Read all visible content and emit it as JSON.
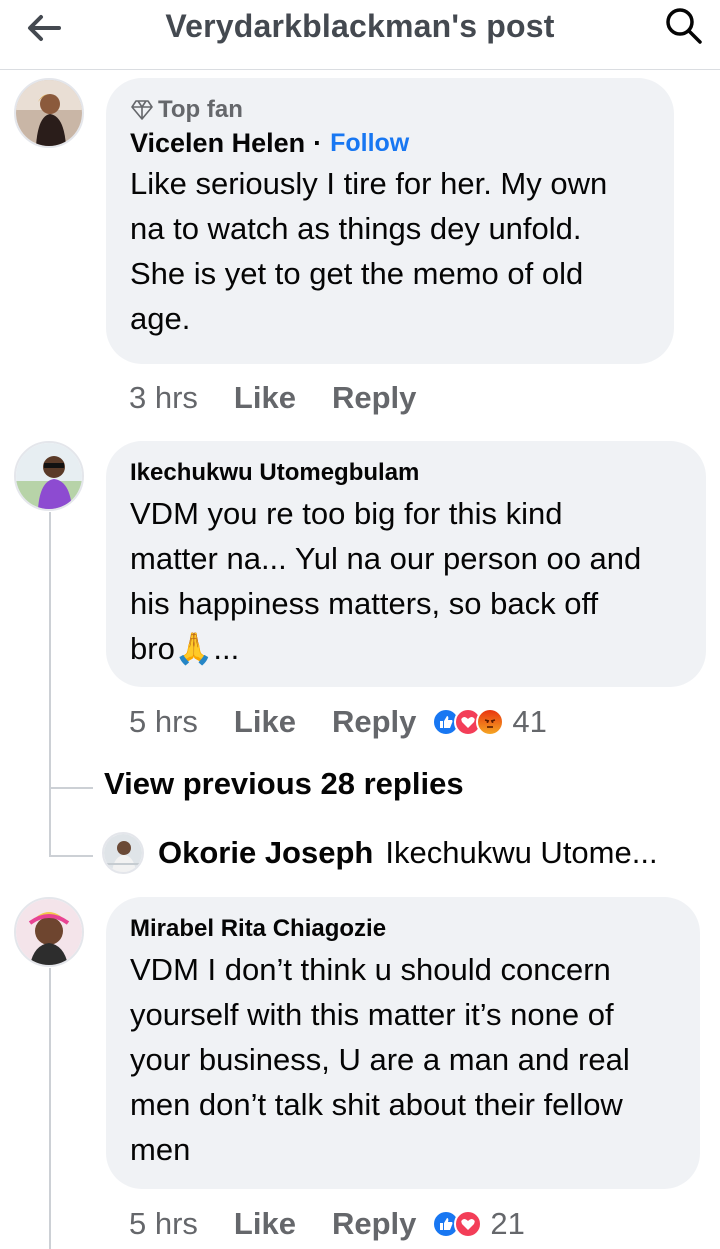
{
  "header": {
    "title": "Verydarkblackman's post"
  },
  "comments": [
    {
      "badge": "Top fan",
      "author": "Vicelen Helen",
      "follow": "Follow",
      "separator": "·",
      "text_lines": [
        "Like seriously I tire for her. My own",
        "na to watch as things dey unfold.",
        "She is yet to get  the memo of old",
        "age."
      ],
      "time": "3 hrs",
      "like": "Like",
      "reply": "Reply"
    },
    {
      "author": "Ikechukwu Utomegbulam",
      "text_lines": [
        "VDM you re too big for this kind",
        "matter na... Yul na our person oo and",
        "his happiness matters, so back off",
        "bro🙏..."
      ],
      "time": "5 hrs",
      "like": "Like",
      "reply": "Reply",
      "reaction_count": "41",
      "reaction_icons": [
        "like-reaction",
        "love-reaction",
        "angry-reaction"
      ]
    },
    {
      "author": "Mirabel Rita Chiagozie",
      "text_lines": [
        "VDM I don’t think u should concern",
        "yourself with this matter it’s none of",
        "your business, U are a man and real",
        "men don’t talk shit about their fellow",
        "men"
      ],
      "time": "5 hrs",
      "like": "Like",
      "reply": "Reply",
      "reaction_count": "21",
      "reaction_icons": [
        "like-reaction",
        "love-reaction"
      ]
    }
  ],
  "view_previous": "View previous 28 replies",
  "reply_preview": {
    "author": "Okorie Joseph",
    "text": "Ikechukwu Utome..."
  },
  "colors": {
    "bubble": "#f0f2f5",
    "meta": "#65676b",
    "link": "#1877f2",
    "like_blue": "#1877f2",
    "love_red": "#f33e58",
    "angry_orange": "#e9710f"
  }
}
